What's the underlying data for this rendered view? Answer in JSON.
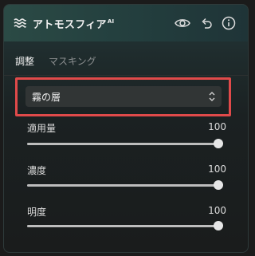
{
  "header": {
    "title": "アトモスフィア",
    "title_suffix": "AI",
    "icon": "atmosphere-waves-icon",
    "actions": [
      {
        "name": "visibility-eye-icon"
      },
      {
        "name": "reset-undo-icon"
      },
      {
        "name": "info-icon"
      }
    ]
  },
  "tabs": {
    "adjust": "調整",
    "masking": "マスキング",
    "active": "調整"
  },
  "preset_select": {
    "value": "霧の層"
  },
  "sliders": [
    {
      "label": "適用量",
      "value": "100",
      "level": 1.0
    },
    {
      "label": "濃度",
      "value": "100",
      "level": 1.0
    },
    {
      "label": "明度",
      "value": "100",
      "level": 1.0
    }
  ],
  "colors": {
    "accent_highlight": "#e04a4a",
    "header_bg": "#2b4a45"
  }
}
